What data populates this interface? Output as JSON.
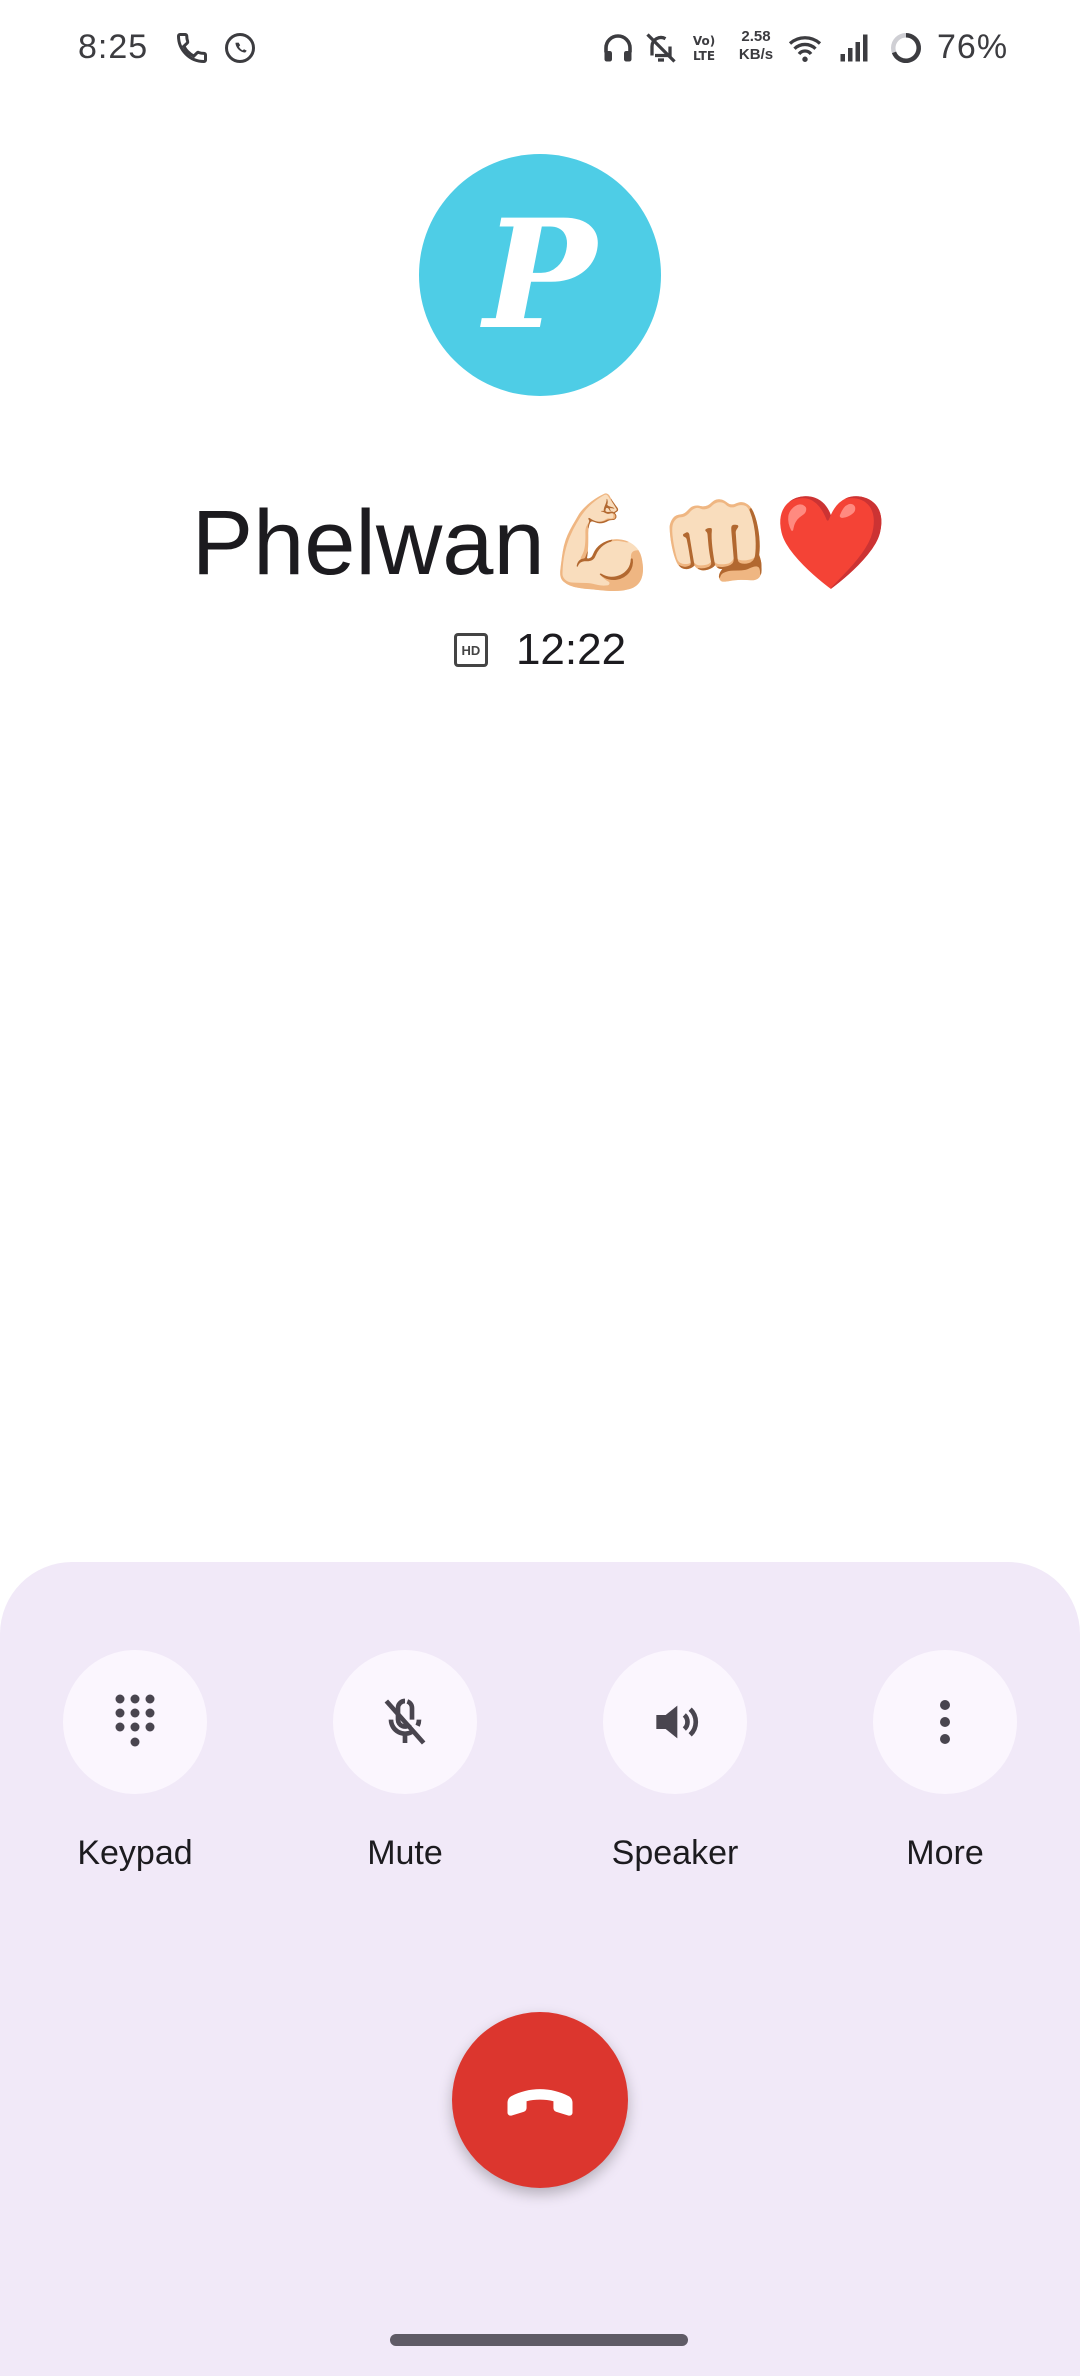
{
  "status_bar": {
    "time": "8:25",
    "net_speed_value": "2.58",
    "net_speed_unit": "KB/s",
    "battery_percent": "76%",
    "icons": [
      "phone-call-icon",
      "whatsapp-icon",
      "headphones-icon",
      "bell-off-icon",
      "volte-icon",
      "wifi-icon",
      "cell-signal-icon",
      "battery-ring-icon"
    ]
  },
  "caller": {
    "avatar_letter": "P",
    "avatar_color": "#4ecde6",
    "name": "Phelwan💪🏻👊🏻❤️",
    "hd_label": "HD",
    "duration": "12:22"
  },
  "controls": {
    "keypad_label": "Keypad",
    "mute_label": "Mute",
    "speaker_label": "Speaker",
    "more_label": "More"
  },
  "end_call": {
    "color": "#dc362e",
    "icon": "phone-hangup-icon"
  }
}
